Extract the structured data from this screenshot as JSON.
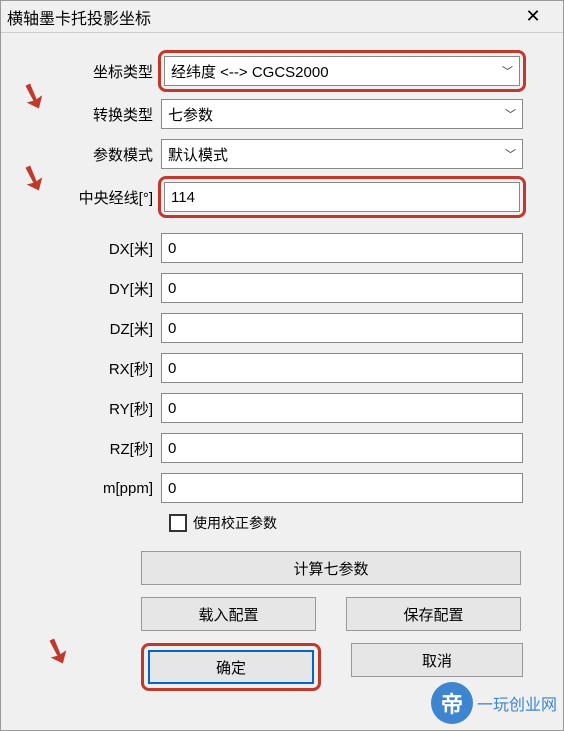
{
  "window": {
    "title": "横轴墨卡托投影坐标"
  },
  "labels": {
    "coord_type": "坐标类型",
    "transform_type": "转换类型",
    "param_mode": "参数模式",
    "central_meridian": "中央经线[°]",
    "dx": "DX[米]",
    "dy": "DY[米]",
    "dz": "DZ[米]",
    "rx": "RX[秒]",
    "ry": "RY[秒]",
    "rz": "RZ[秒]",
    "m": "m[ppm]",
    "use_correction": "使用校正参数"
  },
  "values": {
    "coord_type": "经纬度 <--> CGCS2000",
    "transform_type": "七参数",
    "param_mode": "默认模式",
    "central_meridian": "114",
    "dx": "0",
    "dy": "0",
    "dz": "0",
    "rx": "0",
    "ry": "0",
    "rz": "0",
    "m": "0"
  },
  "buttons": {
    "calc_seven": "计算七参数",
    "load_config": "载入配置",
    "save_config": "保存配置",
    "ok": "确定",
    "cancel": "取消"
  },
  "watermark": {
    "text": "一玩创业网",
    "logo": "帝"
  }
}
